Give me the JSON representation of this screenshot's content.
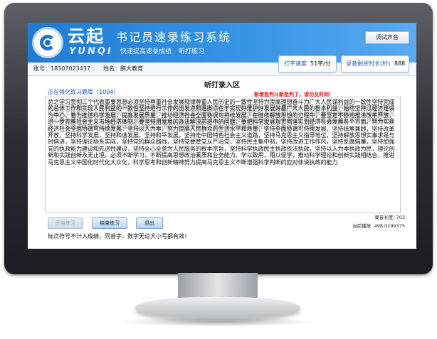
{
  "app": {
    "brand_cn": "云起",
    "title": "书记员速录练习系统",
    "brand_en": "YUNQI",
    "slogan": "快速提高速录成绩",
    "mode": "听打练习",
    "sound_button": "调试声音"
  },
  "info": {
    "account_label": "账号：",
    "account_value": "18307023437",
    "name_label": "姓名：",
    "name_value": "鹏大教育"
  },
  "stats": {
    "speed_label": "打字速度",
    "speed_value": "51字/分",
    "progress_label": "录音剩余时长(秒)",
    "progress_value": "888"
  },
  "main": {
    "section_title": "听打录入区",
    "warning": "新增批判斗新批判了，请勿及时同！",
    "question_bank": "正在强化练习题库（1004）",
    "source_text": "总之学习贯彻三个代表重要思想必须坚持尊重社会发展规律尊重人民历史的一致性坚持为崇高理想奋斗为广大人民谋利益的一致性坚持完成的总体工作和实现人民利益的一致性坚持进行工作的出发点和落脚点在于实现好维护好发展好最广大人民的根本利益，始终坚持以经济建设为中心，着力推进科学发展，提高发展质量，推动经济社会全面协调可持续发展，在继续解放思想的过程中，要坚定不移地推进改革开放，进一步完善社会主义市场经济体制，要坚持用发展的办法解决前进中的问题，要把科学发展观贯彻落实到经济社会发展各个方面，努力实现经济社会全面协调可持续发展，坚持以人为本，努力提高人民群众的生活水平和质量，坚持全面协调可持续发展，坚持统筹兼顾，坚持改革开放，坚持科学发展，坚持和谐发展，坚持和平发展，坚持走中国特色社会主义道路，坚持马克思主义指导地位，坚持解放思想实事求是与时俱进，坚持理论联系实际，坚持党的群众路线，坚持党要管党从严治党，坚持民主集中制，坚持改进工作作风，坚持反腐倡廉，坚持加强党的执政能力建设和先进性建设，坚持全心全意为人民服务的根本宗旨，坚持科学执政民主执政依法执政，坚持以人为本执政为民，理论创新和实践创新永无止境，必须不断学习，不断提高思想政治素质和业务能力，学以致用，用以促学，推动科学理论和创新实践相结合，推进马克思主义中国化时代化大众化，科学思考和创新精神努力提高马克思主义不断增强科学判断的应对体说执政的能力",
    "typed_text": "总之学习贯彻三个代表重要思想必须坚持尊重社会发展规律尊重人民历史的一致性坚持为崇高理想奋斗为广大人民谋利益的一致性坚持完成的总体工作和实现人民利益的一致性坚持进行工作的出发点和落脚点在于实现好维护好发展好最广大人民的根本利益始终坚持以经济建设为中心着力推进科学发展提高发展质量推动经济社会全面协调可持续发展在继续解放思想的过程中要坚定不移地推进改革开放进一步完善社会主义市场经济体制要坚持用发展的办法解决前进中的问题要把科学发展观贯彻落实到经济社会发展各个方面",
    "btn_start": "开始练习",
    "btn_end": "结束练习",
    "btn_exit": "退出",
    "record_length_label": "录音长度:",
    "record_length_value": "703",
    "current_play_label": "当前播放:",
    "current_play_value": "498.0299375",
    "note": "标点符号不计入成绩，同音字，数字无论大小写都有效！"
  }
}
